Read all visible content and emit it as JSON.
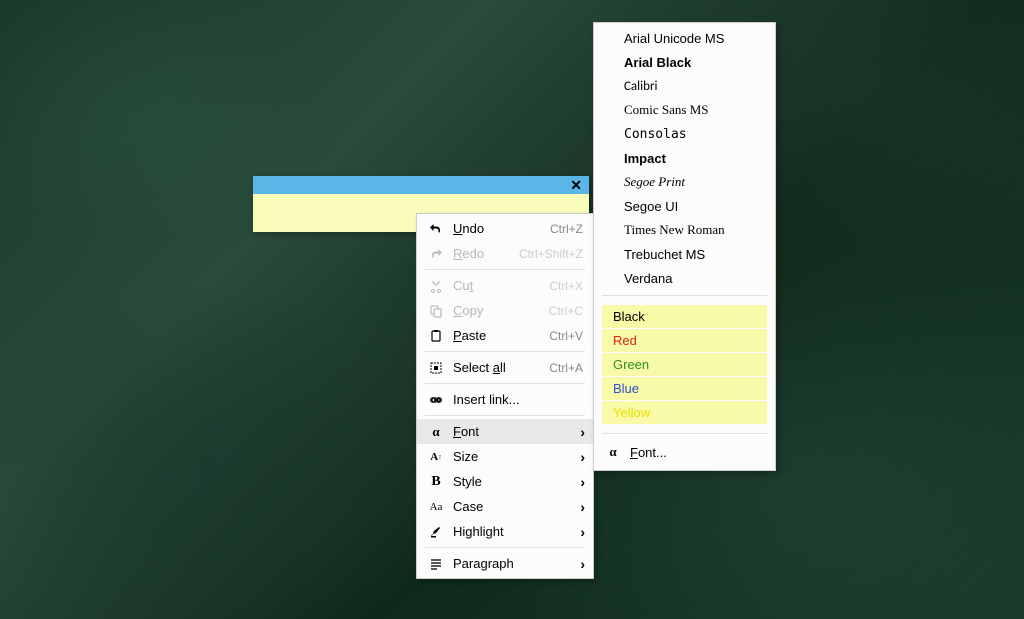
{
  "sticky_note": {
    "close": "✕"
  },
  "context_menu": {
    "undo": {
      "label": "Undo",
      "shortcut": "Ctrl+Z"
    },
    "redo": {
      "label": "Redo",
      "shortcut": "Ctrl+Shift+Z"
    },
    "cut": {
      "label": "Cut",
      "shortcut": "Ctrl+X"
    },
    "copy": {
      "label": "Copy",
      "shortcut": "Ctrl+C"
    },
    "paste": {
      "label": "Paste",
      "shortcut": "Ctrl+V"
    },
    "select_all": {
      "label": "Select all",
      "shortcut": "Ctrl+A"
    },
    "insert_link": {
      "label": "Insert link..."
    },
    "font": {
      "label": "Font"
    },
    "size": {
      "label": "Size"
    },
    "style": {
      "label": "Style"
    },
    "case": {
      "label": "Case"
    },
    "highlight": {
      "label": "Highlight"
    },
    "paragraph": {
      "label": "Paragraph"
    }
  },
  "font_submenu": {
    "fonts": [
      "Arial Unicode MS",
      "Arial Black",
      "Calibri",
      "Comic Sans MS",
      "Consolas",
      "Impact",
      "Segoe Print",
      "Segoe UI",
      "Times New Roman",
      "Trebuchet MS",
      "Verdana"
    ],
    "colors": [
      {
        "label": "Black",
        "color": "#000000"
      },
      {
        "label": "Red",
        "color": "#e02020"
      },
      {
        "label": "Green",
        "color": "#2a9020"
      },
      {
        "label": "Blue",
        "color": "#3050d0"
      },
      {
        "label": "Yellow",
        "color": "#e8e000"
      }
    ],
    "more": "Font..."
  }
}
